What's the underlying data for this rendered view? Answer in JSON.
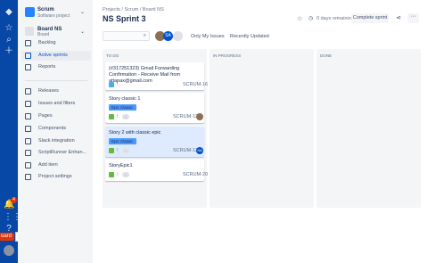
{
  "global_nav": {
    "notifications_count": "4"
  },
  "board_pill": {
    "label": "oard",
    "pause": "II"
  },
  "sidebar": {
    "project_name": "Scrum",
    "project_type": "Software project",
    "board_name": "Board NS",
    "board_sub": "Board",
    "items": [
      {
        "label": "Backlog",
        "icon": "backlog-icon"
      },
      {
        "label": "Active sprints",
        "icon": "sprint-icon",
        "active": true
      },
      {
        "label": "Reports",
        "icon": "reports-icon"
      },
      {
        "label": "Releases",
        "icon": "releases-icon"
      },
      {
        "label": "Issues and filters",
        "icon": "issues-icon"
      },
      {
        "label": "Pages",
        "icon": "pages-icon"
      },
      {
        "label": "Components",
        "icon": "components-icon"
      },
      {
        "label": "Slack integration",
        "icon": "slack-icon"
      },
      {
        "label": "ScriptRunner Enhan...",
        "icon": "scriptrunner-icon"
      },
      {
        "label": "Add item",
        "icon": "add-item-icon"
      },
      {
        "label": "Project settings",
        "icon": "settings-icon"
      }
    ]
  },
  "header": {
    "breadcrumbs": "Projects  /  Scrum  /  Board NS",
    "title": "NS Sprint 3",
    "days_remaining": "0 days remaining",
    "complete_label": "Complete sprint",
    "more": "···"
  },
  "filters": {
    "search_placeholder": "",
    "avatars": [
      "",
      "SA",
      ""
    ],
    "only_my_issues": "Only My Issues",
    "recently_updated": "Recently Updated"
  },
  "columns": [
    {
      "name": "TO DO"
    },
    {
      "name": "IN PROGRESS"
    },
    {
      "name": "DONE"
    }
  ],
  "cards": [
    {
      "title": "(#317251323) Gmail Forwarding Confirmation - Receive Mail from attapax@gmail.com",
      "epic": "",
      "type": "task",
      "estimate": "",
      "key": "SCRUM-16",
      "assignee": ""
    },
    {
      "title": "Story classic 1",
      "epic": "Epic Classic",
      "type": "story",
      "estimate": "-",
      "key": "SCRUM-12",
      "assignee": ""
    },
    {
      "title": "Story 2 with classic epic",
      "epic": "Epic Classic",
      "type": "story",
      "estimate": "-",
      "key": "SCRUM-13",
      "assignee": "SA"
    },
    {
      "title": "StoryEpic1",
      "epic": "",
      "type": "story",
      "estimate": "-",
      "key": "SCRUM-20",
      "assignee": ""
    }
  ],
  "colors": {
    "global_nav": "#0747a6",
    "accent": "#0052cc",
    "epic": "#4c9aff",
    "selected_card": "#deebff"
  }
}
